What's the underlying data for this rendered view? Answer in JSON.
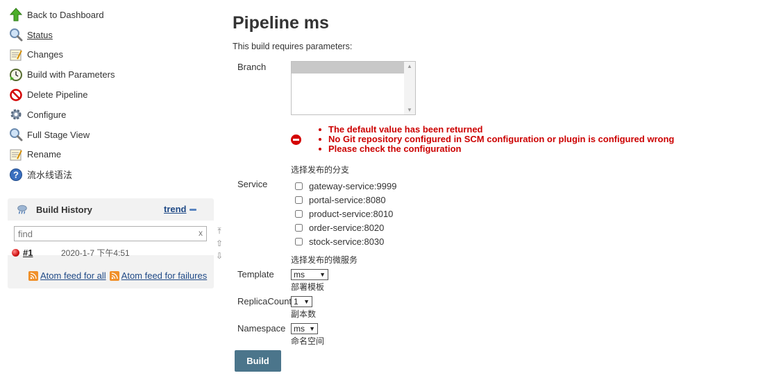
{
  "sidebar": {
    "items": [
      {
        "label": "Back to Dashboard"
      },
      {
        "label": "Status"
      },
      {
        "label": "Changes"
      },
      {
        "label": "Build with Parameters"
      },
      {
        "label": "Delete Pipeline"
      },
      {
        "label": "Configure"
      },
      {
        "label": "Full Stage View"
      },
      {
        "label": "Rename"
      },
      {
        "label": "流水线语法"
      }
    ]
  },
  "build_history": {
    "title": "Build History",
    "trend_label": "trend",
    "search_placeholder": "find",
    "search_clear": "x",
    "builds": [
      {
        "number": "#1",
        "date": "2020-1-7 下午4:51",
        "status_color": "#d41a1a"
      }
    ],
    "feed_all": "Atom feed for all",
    "feed_failures": "Atom feed for failures"
  },
  "main": {
    "title": "Pipeline ms",
    "description": "This build requires parameters:",
    "branch": {
      "label": "Branch",
      "errors": [
        "The default value has been returned",
        "No Git repository configured in SCM configuration or plugin is configured wrong",
        "Please check the configuration"
      ],
      "description": "选择发布的分支"
    },
    "service": {
      "label": "Service",
      "options": [
        "gateway-service:9999",
        "portal-service:8080",
        "product-service:8010",
        "order-service:8020",
        "stock-service:8030"
      ],
      "description": "选择发布的微服务"
    },
    "template": {
      "label": "Template",
      "value": "ms",
      "description": "部署模板"
    },
    "replica_count": {
      "label": "ReplicaCount",
      "value": "1",
      "description": "副本数"
    },
    "namespace": {
      "label": "Namespace",
      "value": "ms",
      "description": "命名空间"
    },
    "build_button": "Build"
  },
  "colors": {
    "build_button": "#4b758b",
    "error": "#cc0000",
    "link": "#204a87"
  }
}
